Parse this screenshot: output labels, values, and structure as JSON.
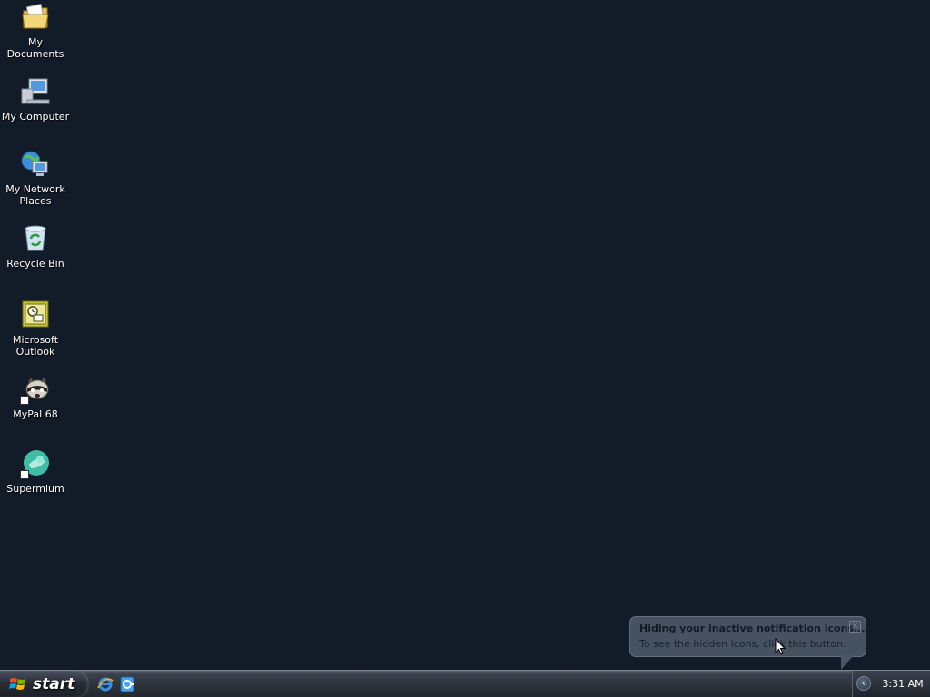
{
  "desktop": {
    "icons": [
      {
        "label": "My Documents",
        "icon": "folder-documents-icon"
      },
      {
        "label": "My Computer",
        "icon": "computer-icon"
      },
      {
        "label": "My Network Places",
        "icon": "network-places-icon"
      },
      {
        "label": "Recycle Bin",
        "icon": "recycle-bin-icon"
      },
      {
        "label": "Microsoft Outlook",
        "icon": "outlook-icon"
      },
      {
        "label": "MyPal 68",
        "icon": "mypal-icon"
      },
      {
        "label": "Supermium",
        "icon": "supermium-icon"
      }
    ]
  },
  "taskbar": {
    "start_label": "start",
    "quicklaunch": [
      "internet-explorer-icon",
      "outlook-express-icon"
    ],
    "clock": "3:31 AM",
    "tray_chevron": "‹"
  },
  "balloon": {
    "title": "Hiding your inactive notification icons...",
    "text": "To see the hidden icons, click this button.",
    "close": "✕"
  },
  "colors": {
    "desktop_bg": "#121b28",
    "taskbar": "#2c313a",
    "balloon_bg": "#4a5565"
  }
}
